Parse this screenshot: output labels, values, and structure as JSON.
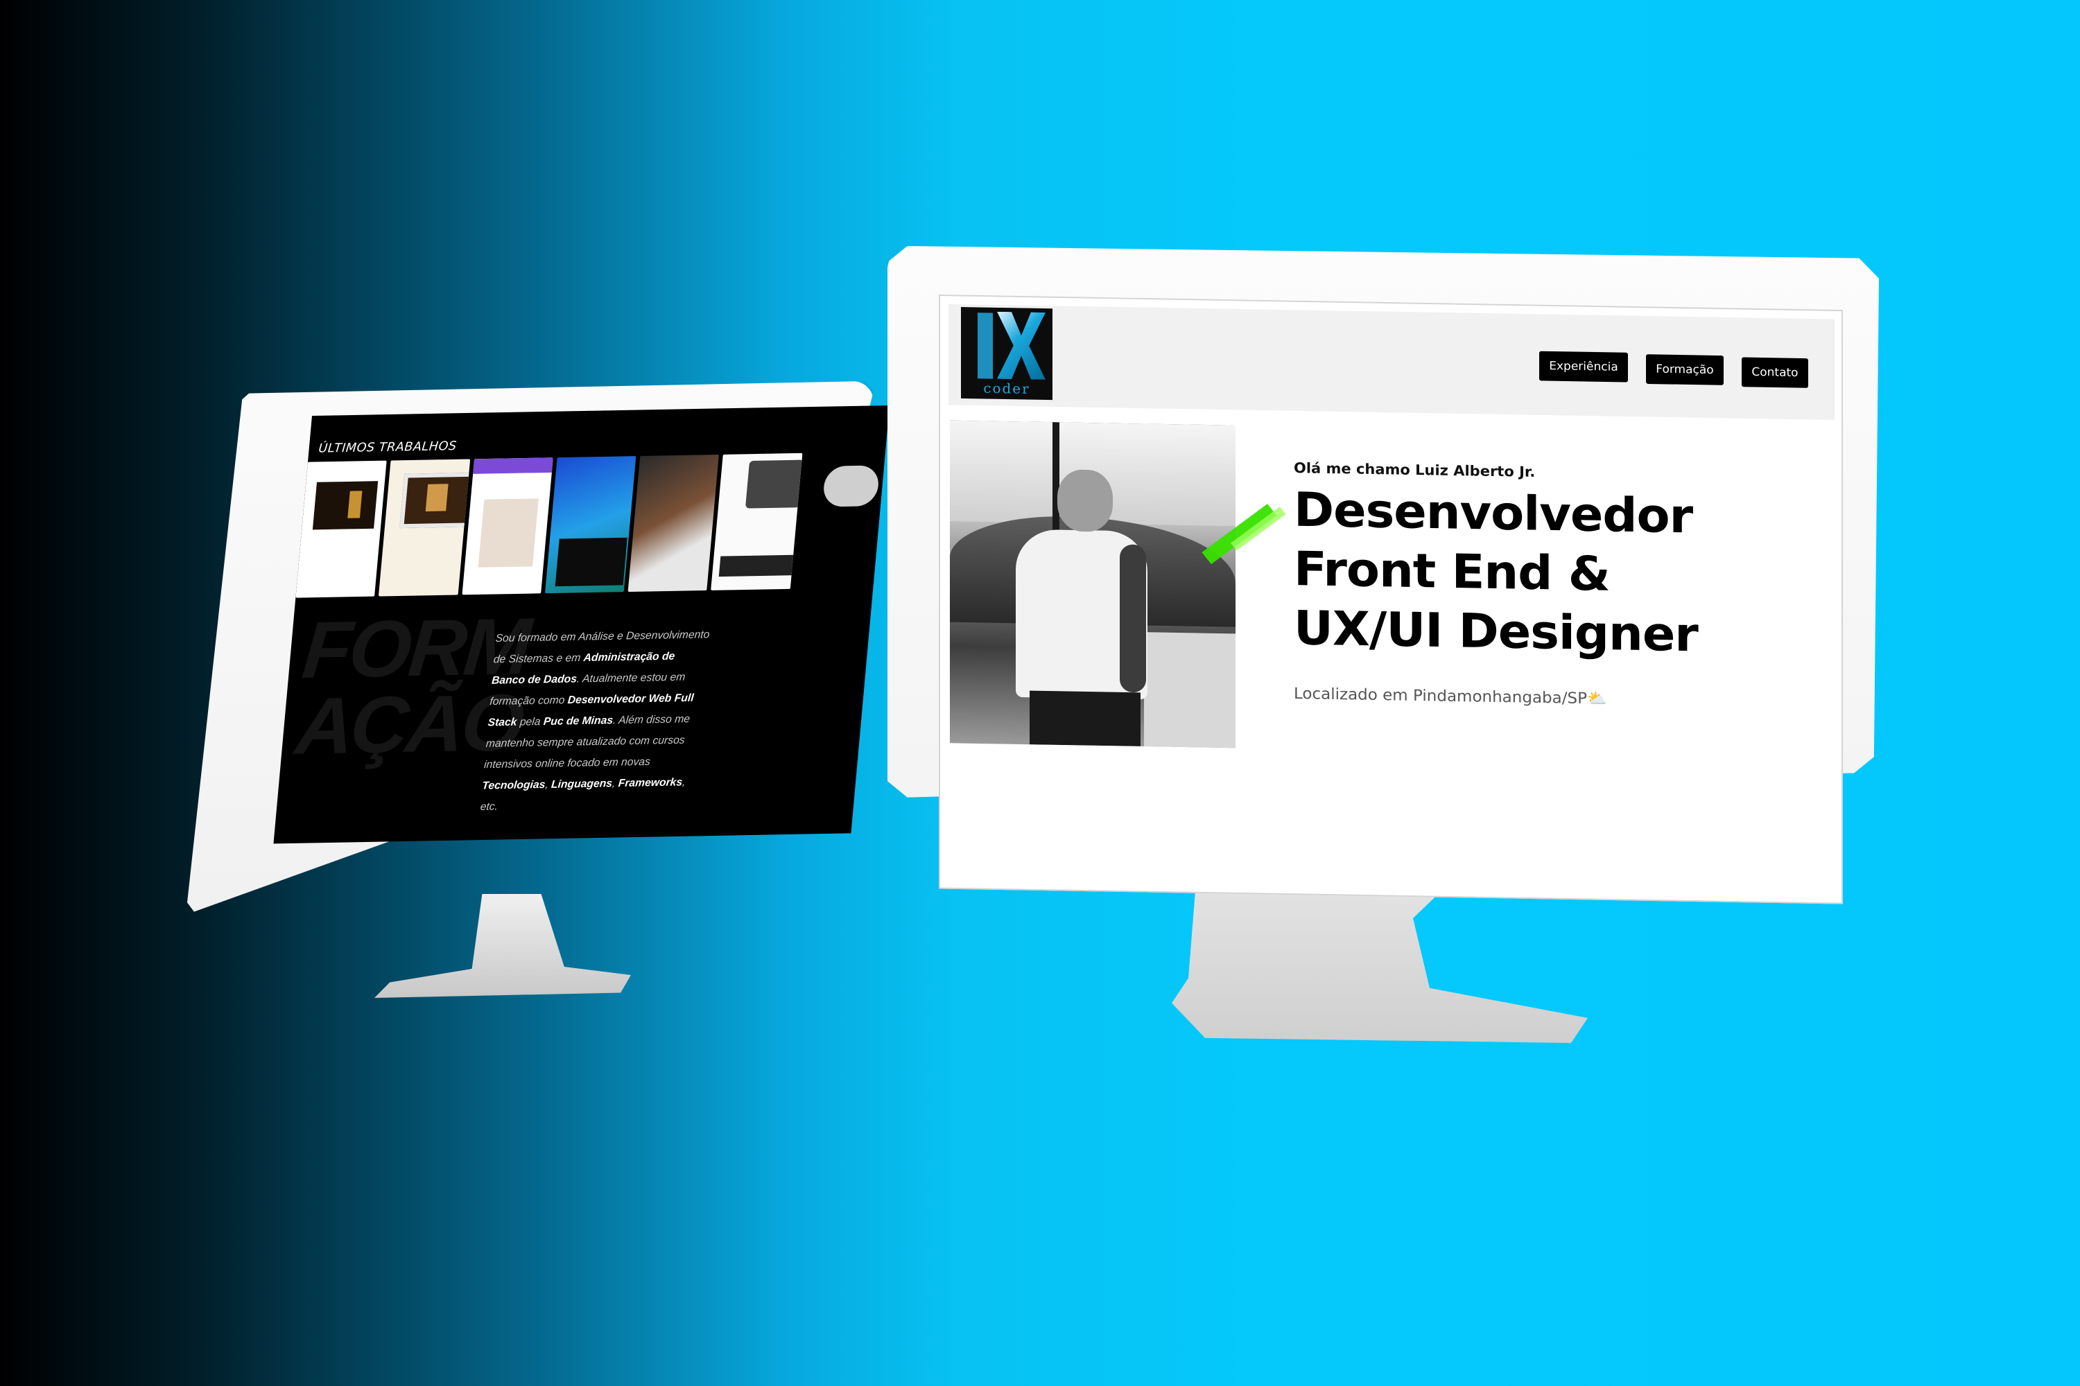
{
  "left_screen": {
    "section_title": "ÚLTIMOS TRABALHOS",
    "formacao_heading_lines": [
      "FORM",
      "AÇÃO"
    ],
    "paragraph": {
      "p1": "Sou formado em Análise e Desenvolvimento de Sistemas e em ",
      "b1": "Administração de Banco de Dados",
      "p2": ". Atualmente estou em formação como ",
      "b2": "Desenvolvedor Web Full Stack",
      "p3": " pela ",
      "b3": "Puc de Minas",
      "p4": ". Além disso me mantenho sempre atualizado com cursos intensivos online focado em novas ",
      "b4": "Tecnologias",
      "p5": ", ",
      "b5": "Linguagens",
      "p6": ", ",
      "b6": "Frameworks",
      "p7": ", etc."
    }
  },
  "right_screen": {
    "logo_text": "coder",
    "nav": [
      {
        "label": "Experiência"
      },
      {
        "label": "Formação"
      },
      {
        "label": "Contato"
      }
    ],
    "hero": {
      "greeting": "Olá me chamo Luiz Alberto Jr.",
      "headline_lines": [
        "Desenvolvedor",
        "Front End &",
        "UX/UI Designer"
      ],
      "location": "Localizado em Pindamonhangaba/SP",
      "location_icon": "⛅"
    }
  },
  "colors": {
    "accent_green": "#38e000",
    "logo_blue": "#1aa8dd",
    "background_cyan": "#05c8fb"
  }
}
